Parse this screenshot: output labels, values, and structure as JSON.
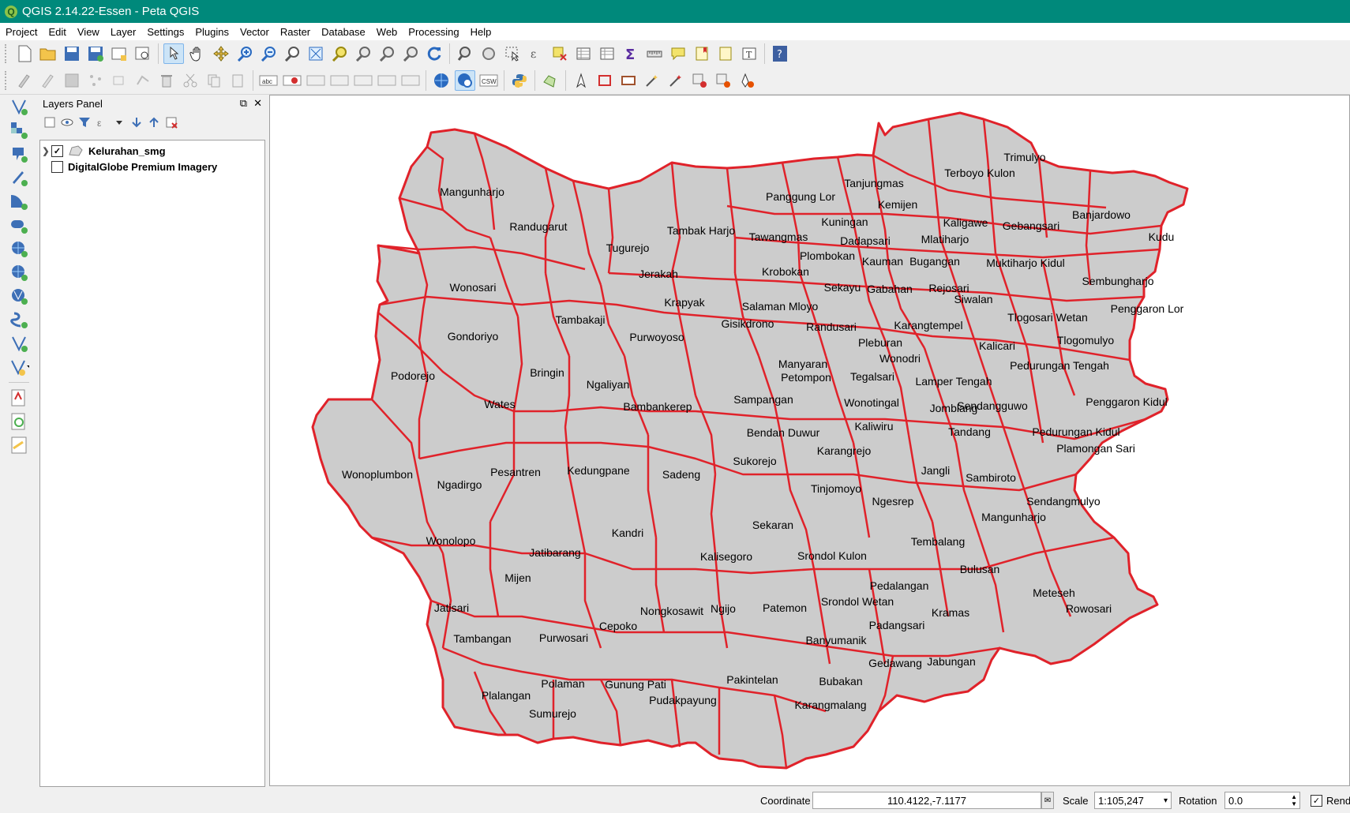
{
  "window": {
    "title": "QGIS 2.14.22-Essen - Peta QGIS"
  },
  "menu": [
    "Project",
    "Edit",
    "View",
    "Layer",
    "Settings",
    "Plugins",
    "Vector",
    "Raster",
    "Database",
    "Web",
    "Processing",
    "Help"
  ],
  "layers_panel": {
    "title": "Layers Panel",
    "layers": [
      {
        "name": "Kelurahan_smg",
        "checked": true
      },
      {
        "name": "DigitalGlobe Premium Imagery",
        "checked": false
      }
    ]
  },
  "map": {
    "fill_color": "#cccccc",
    "stroke_color": "#e0222a",
    "labels": [
      "Mangunharjo",
      "Randugarut",
      "Tugurejo",
      "Jerakah",
      "Tambak Harjo",
      "Panggung Lor",
      "Tanjungmas",
      "Terboyo Kulon",
      "Trimulyo",
      "Kemijen",
      "Kaligawe",
      "Banjardowo",
      "Gebangsari",
      "Kudu",
      "Kuningan",
      "Tawangmas",
      "Dadapsari",
      "Mlatiharjo",
      "Plombokan",
      "Kauman",
      "Bugangan",
      "Muktiharjo Kidul",
      "Krobokan",
      "Sembungharjo",
      "Wonosari",
      "Sekayu",
      "Gabahan",
      "Rejosari",
      "Krapyak",
      "Salaman Mloyo",
      "Siwalan",
      "Penggaron Lor",
      "Tambakaji",
      "Gisikdrono",
      "Randusari",
      "Karangtempel",
      "Tlogosari Wetan",
      "Gondoriyo",
      "Purwoyoso",
      "Pleburan",
      "Tlogomulyo",
      "Kalicari",
      "Wonodri",
      "Bringin",
      "Manyaran",
      "Petompon",
      "Pedurungan Tengah",
      "Podorejo",
      "Ngaliyan",
      "Tegalsari",
      "Lamper Tengah",
      "Penggaron Kidul",
      "Wates",
      "Sampangan",
      "Wonotingal",
      "Jomblang",
      "Sendangguwo",
      "Bambankerep",
      "Kaliwiru",
      "Tandang",
      "Pedurungan Kidul",
      "Bendan Duwur",
      "Plamongan Sari",
      "Karangrejo",
      "Sukorejo",
      "Wonoplumbon",
      "Pesantren",
      "Kedungpane",
      "Sadeng",
      "Jangli",
      "Sambiroto",
      "Ngadirgo",
      "Tinjomoyo",
      "Ngesrep",
      "Sendangmulyo",
      "Mangunharjo",
      "Sekaran",
      "Kandri",
      "Wonolopo",
      "Tembalang",
      "Jatibarang",
      "Kalisegoro",
      "Srondol Kulon",
      "Bulusan",
      "Mijen",
      "Pedalangan",
      "Meteseh",
      "Srondol Wetan",
      "Jatisari",
      "Nongkosawit",
      "Ngijo",
      "Patemon",
      "Rowosari",
      "Kramas",
      "Cepoko",
      "Padangsari",
      "Tambangan",
      "Purwosari",
      "Banyumanik",
      "Gedawang",
      "Jabungan",
      "Polaman",
      "Gunung Pati",
      "Pakintelan",
      "Bubakan",
      "Plalangan",
      "Pudakpayung",
      "Karangmalang",
      "Sumurejo"
    ]
  },
  "status": {
    "coordinate_label": "Coordinate",
    "coordinate_value": "110.4122,-7.1177",
    "scale_label": "Scale",
    "scale_value": "1:105,247",
    "rotation_label": "Rotation",
    "rotation_value": "0.0",
    "render_label": "Rend"
  }
}
